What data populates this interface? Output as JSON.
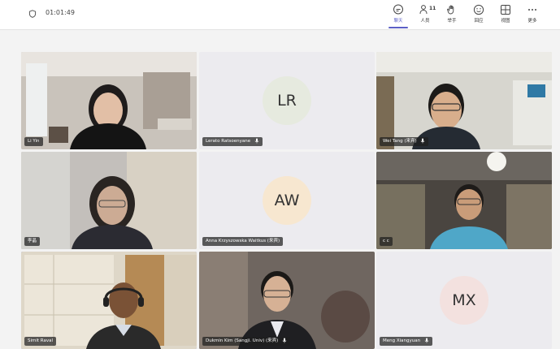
{
  "call": {
    "timer": "01:01:49"
  },
  "toolbar": {
    "chat": "聊天",
    "people": "人员",
    "people_count": "11",
    "raise_hand": "举手",
    "react": "回应",
    "view": "视图",
    "more": "更多"
  },
  "participants": [
    {
      "name": "Li Yin",
      "type": "video"
    },
    {
      "name": "Lerato Ratsoenyane",
      "type": "avatar",
      "initials": "LR",
      "avatar_color": "#e6eadf"
    },
    {
      "name": "Wei Tang (来宾)",
      "type": "video"
    },
    {
      "name": "李晶",
      "type": "video"
    },
    {
      "name": "Anna Krzyszowska Waitkus (来宾)",
      "type": "avatar",
      "initials": "AW",
      "avatar_color": "#f7e7d0"
    },
    {
      "name": "c c",
      "type": "video"
    },
    {
      "name": "Simit Raval",
      "type": "video"
    },
    {
      "name": "Dukmin Kim (Sangji. Univ) (来宾)",
      "type": "video"
    },
    {
      "name": "Meng Xiangyuan",
      "type": "avatar",
      "initials": "MX",
      "avatar_color": "#f3e1df"
    }
  ],
  "colors": {
    "accent": "#5b5fc7",
    "active_outline": "#7b7fe0"
  }
}
